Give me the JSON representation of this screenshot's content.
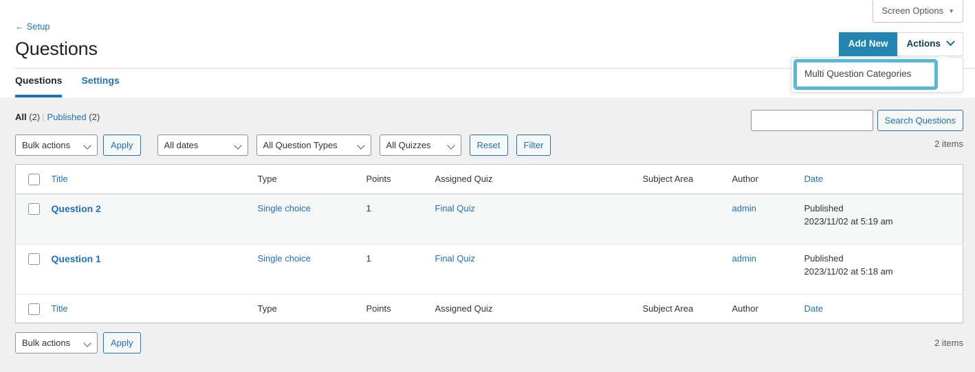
{
  "header": {
    "screen_options_label": "Screen Options",
    "screen_options_caret": "▼",
    "back_link": "← Setup",
    "title": "Questions",
    "tabs": [
      {
        "label": "Questions",
        "active": true
      },
      {
        "label": "Settings",
        "active": false
      }
    ],
    "add_new_label": "Add New",
    "actions_label": "Actions"
  },
  "dropdown": {
    "items": [
      {
        "label": "Multi Question Categories",
        "highlighted": true
      }
    ],
    "highlight_color": "#5cb7d6"
  },
  "views": {
    "all_label": "All",
    "all_count": "(2)",
    "separator": "|",
    "published_label": "Published",
    "published_count": "(2)"
  },
  "search": {
    "value": "",
    "placeholder": "",
    "button_label": "Search Questions"
  },
  "filters": {
    "bulk_actions": "Bulk actions",
    "apply_label": "Apply",
    "all_dates": "All dates",
    "all_question_types": "All Question Types",
    "all_quizzes": "All Quizzes",
    "reset_label": "Reset",
    "filter_label": "Filter"
  },
  "counts": {
    "top_items": "2 items",
    "bottom_items": "2 items"
  },
  "table": {
    "columns": [
      {
        "key": "cb",
        "label": "",
        "sortable": false
      },
      {
        "key": "title",
        "label": "Title",
        "sortable": true
      },
      {
        "key": "type",
        "label": "Type",
        "sortable": false
      },
      {
        "key": "points",
        "label": "Points",
        "sortable": false
      },
      {
        "key": "quiz",
        "label": "Assigned Quiz",
        "sortable": false
      },
      {
        "key": "subject",
        "label": "Subject Area",
        "sortable": false
      },
      {
        "key": "author",
        "label": "Author",
        "sortable": false
      },
      {
        "key": "date",
        "label": "Date",
        "sortable": true
      }
    ],
    "rows": [
      {
        "title": "Question 2",
        "type": "Single choice",
        "points": "1",
        "quiz": "Final Quiz",
        "subject": "",
        "author": "admin",
        "date_status": "Published",
        "date_value": "2023/11/02 at 5:19 am"
      },
      {
        "title": "Question 1",
        "type": "Single choice",
        "points": "1",
        "quiz": "Final Quiz",
        "subject": "",
        "author": "admin",
        "date_status": "Published",
        "date_value": "2023/11/02 at 5:18 am"
      }
    ]
  },
  "bottom_nav": {
    "bulk_actions": "Bulk actions",
    "apply_label": "Apply"
  },
  "colors": {
    "accent_blue": "#2271b1",
    "add_new_blue": "#2185b0",
    "highlight_teal": "#5cb7d6",
    "page_bg": "#f0f0f1"
  }
}
